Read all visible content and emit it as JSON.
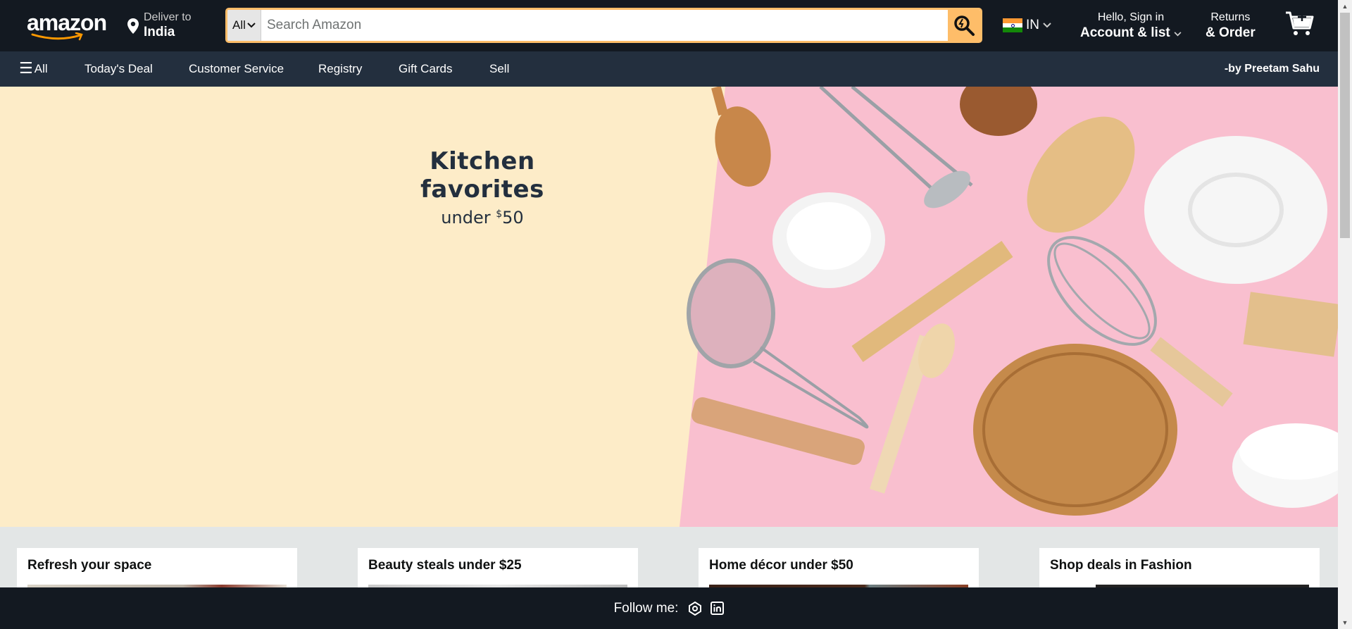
{
  "header": {
    "logo_text": "amazon",
    "deliver_small": "Deliver to",
    "deliver_big": "India",
    "search_category": "All",
    "search_placeholder": "Search Amazon",
    "language": "IN",
    "account_small": "Hello, Sign in",
    "account_big": "Account & list",
    "returns_small": "Returns",
    "returns_big": "& Order"
  },
  "subnav": {
    "all_label": "All",
    "items": [
      "Today's Deal",
      "Customer Service",
      "Registry",
      "Gift Cards",
      "Sell"
    ],
    "byline": "-by Preetam Sahu"
  },
  "hero": {
    "title": "Kitchen favorites",
    "subtitle_prefix": "under ",
    "subtitle_currency": "$",
    "subtitle_amount": "50"
  },
  "cards": [
    {
      "title": "Refresh your space"
    },
    {
      "title": "Beauty steals under $25"
    },
    {
      "title": "Home décor under $50"
    },
    {
      "title": "Shop deals in Fashion"
    }
  ],
  "footer": {
    "follow_label": "Follow me:"
  },
  "colors": {
    "nav_dark": "#131921",
    "nav_secondary": "#232f3e",
    "search_accent": "#febd69",
    "hero_cream": "#fdecc8",
    "hero_pink": "#f9bfcf"
  }
}
